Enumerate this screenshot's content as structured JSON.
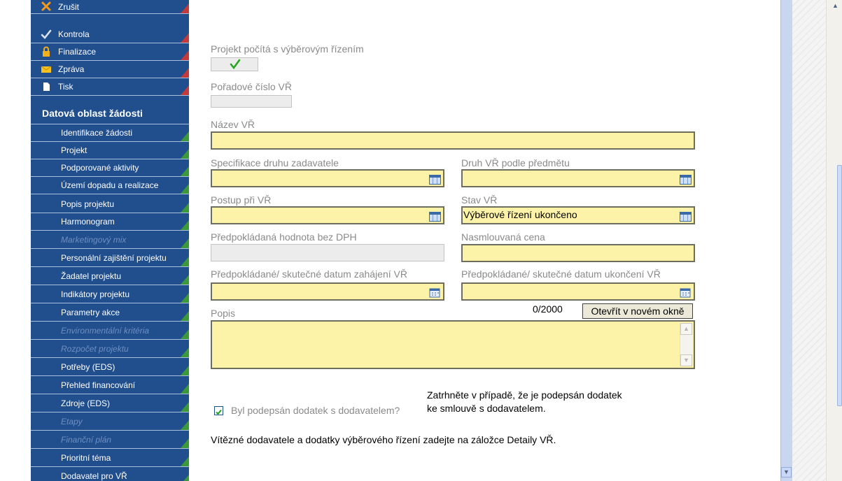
{
  "sidebar": {
    "top_items": [
      {
        "label": "Zrušit",
        "icon": "cancel-icon"
      },
      {
        "label": "Kontrola",
        "icon": "checkmark-icon"
      },
      {
        "label": "Finalizace",
        "icon": "lock-icon"
      },
      {
        "label": "Zpráva",
        "icon": "envelope-icon"
      },
      {
        "label": "Tisk",
        "icon": "document-icon"
      }
    ],
    "section_title": "Datová oblast žádosti",
    "items": [
      {
        "label": "Identifikace žádosti",
        "enabled": true
      },
      {
        "label": "Projekt",
        "enabled": true
      },
      {
        "label": "Podporované aktivity",
        "enabled": true
      },
      {
        "label": "Území dopadu a realizace",
        "enabled": true
      },
      {
        "label": "Popis projektu",
        "enabled": true
      },
      {
        "label": "Harmonogram",
        "enabled": true
      },
      {
        "label": "Marketingový mix",
        "enabled": false
      },
      {
        "label": "Personální zajištění projektu",
        "enabled": true
      },
      {
        "label": "Žadatel projektu",
        "enabled": true
      },
      {
        "label": "Indikátory projektu",
        "enabled": true
      },
      {
        "label": "Parametry akce",
        "enabled": true
      },
      {
        "label": "Environmentální kritéria",
        "enabled": false
      },
      {
        "label": "Rozpočet projektu",
        "enabled": false
      },
      {
        "label": "Potřeby (EDS)",
        "enabled": true
      },
      {
        "label": "Přehled financování",
        "enabled": true
      },
      {
        "label": "Zdroje (EDS)",
        "enabled": true
      },
      {
        "label": "Etapy",
        "enabled": false
      },
      {
        "label": "Finanční plán",
        "enabled": false
      },
      {
        "label": "Prioritní téma",
        "enabled": true
      },
      {
        "label": "Dodavatel pro VŘ",
        "enabled": true
      }
    ]
  },
  "form": {
    "tender_flag_label": "Projekt počítá s výběrovým řízením",
    "tender_flag_checked": true,
    "order_number_label": "Pořadové číslo VŘ",
    "order_number_value": "",
    "name_label": "Název VŘ",
    "name_value": "",
    "contracting_type_label": "Specifikace druhu zadavatele",
    "contracting_type_value": "",
    "subject_type_label": "Druh VŘ podle předmětu",
    "subject_type_value": "",
    "procedure_label": "Postup při VŘ",
    "procedure_value": "",
    "status_label": "Stav VŘ",
    "status_value": "Výběrové řízení ukončeno",
    "estimated_value_label": "Předpokládaná hodnota bez DPH",
    "estimated_value": "",
    "contract_price_label": "Nasmlouvaná cena",
    "contract_price_value": "",
    "start_date_label": "Předpokládané/ skutečné datum zahájení VŘ",
    "start_date_value": "",
    "end_date_label": "Předpokládané/ skutečné datum ukončení VŘ",
    "end_date_value": "",
    "description_label": "Popis",
    "description_counter": "0/2000",
    "open_window_button": "Otevřít v novém okně",
    "description_value": "",
    "amendment_label": "Byl podepsán dodatek s dodavatelem?",
    "amendment_checked": true,
    "amendment_hint_line1": "Zatrhněte v případě, že je podepsán dodatek",
    "amendment_hint_line2": "ke smlouvě s dodavatelem.",
    "footer_note": "Vítězné dodavatele a dodatky výběrového řízení zadejte na záložce Detaily VŘ."
  }
}
